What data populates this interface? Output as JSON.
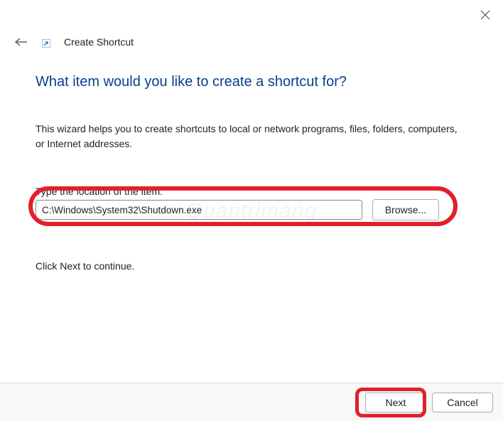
{
  "header": {
    "title": "Create Shortcut"
  },
  "main": {
    "heading": "What item would you like to create a shortcut for?",
    "description": "This wizard helps you to create shortcuts to local or network programs, files, folders, computers, or Internet addresses.",
    "input_label": "Type the location of the item:",
    "input_value": "C:\\Windows\\System32\\Shutdown.exe",
    "browse_label": "Browse...",
    "continue_text": "Click Next to continue."
  },
  "footer": {
    "next_label": "Next",
    "cancel_label": "Cancel"
  },
  "watermark": "Quantrimang"
}
